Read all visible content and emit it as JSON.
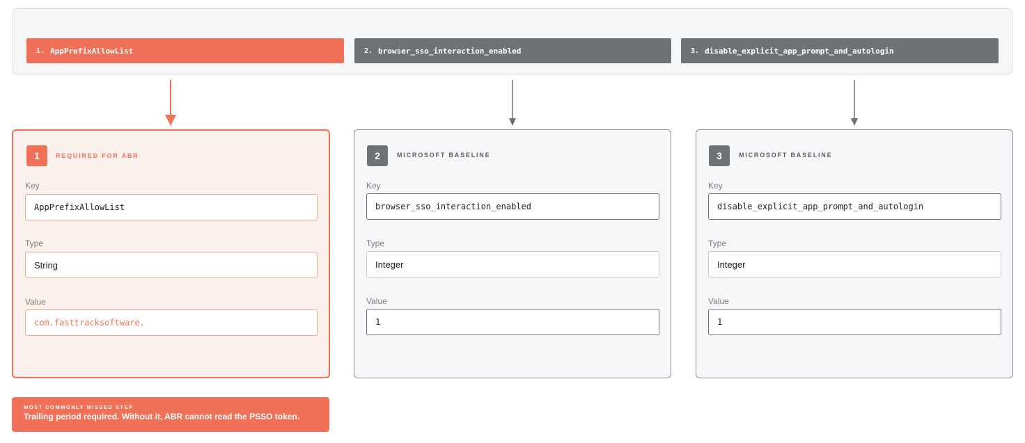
{
  "steps": [
    {
      "num": "1.",
      "tab_label": "AppPrefixAllowList",
      "badge": "1",
      "tag": "REQUIRED FOR ABR",
      "key_label": "Key",
      "key": "AppPrefixAllowList",
      "type_label": "Type",
      "type": "String",
      "value_label": "Value",
      "value": "com.fasttracksoftware."
    },
    {
      "num": "2.",
      "tab_label": "browser_sso_interaction_enabled",
      "badge": "2",
      "tag": "MICROSOFT BASELINE",
      "key_label": "Key",
      "key": "browser_sso_interaction_enabled",
      "type_label": "Type",
      "type": "Integer",
      "value_label": "Value",
      "value": "1"
    },
    {
      "num": "3.",
      "tab_label": "disable_explicit_app_prompt_and_autologin",
      "badge": "3",
      "tag": "MICROSOFT BASELINE",
      "key_label": "Key",
      "key": "disable_explicit_app_prompt_and_autologin",
      "type_label": "Type",
      "type": "Integer",
      "value_label": "Value",
      "value": "1"
    }
  ],
  "callout": {
    "title": "MOST COMMONLY MISSED STEP",
    "message": "Trailing period required. Without it, ABR cannot read the PSSO token."
  },
  "colors": {
    "accent": "#f07157",
    "neutral": "#6e7176",
    "accent_bg": "#faf0ec",
    "panel_bg": "#f6f7f9"
  }
}
